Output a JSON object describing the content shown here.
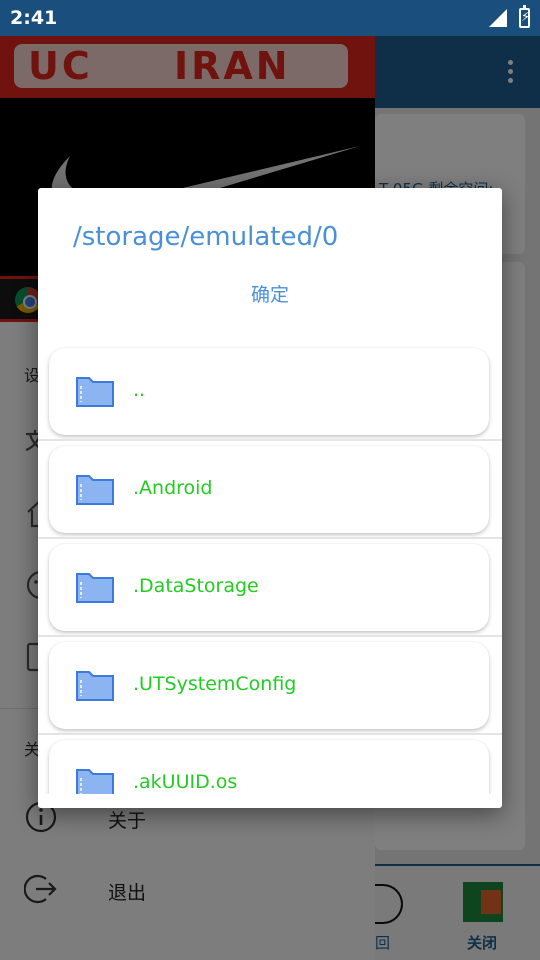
{
  "status_bar": {
    "time": "2:41"
  },
  "background_app": {
    "card_text": "T 05G  剩余空间:",
    "bottom_nav": {
      "back_label": "回",
      "close_label": "关闭"
    }
  },
  "drawer": {
    "banner": {
      "uc": "UC",
      "iran": "IRAN"
    },
    "section_settings": "设",
    "section_about": "关",
    "items": [
      {
        "label": "关于",
        "icon": "info-icon"
      },
      {
        "label": "退出",
        "icon": "logout-icon"
      }
    ]
  },
  "dialog": {
    "title": "/storage/emulated/0",
    "confirm_label": "确定",
    "files": [
      {
        "name": "..",
        "icon": "folder-icon"
      },
      {
        "name": ".Android",
        "icon": "folder-icon"
      },
      {
        "name": ".DataStorage",
        "icon": "folder-icon"
      },
      {
        "name": ".UTSystemConfig",
        "icon": "folder-icon"
      },
      {
        "name": ".akUUID.os",
        "icon": "folder-icon"
      }
    ]
  },
  "colors": {
    "status_bar": "#1a4f7d",
    "accent_blue": "#4a90d9",
    "file_name_green": "#22cc22",
    "banner_red": "#e1251b"
  }
}
